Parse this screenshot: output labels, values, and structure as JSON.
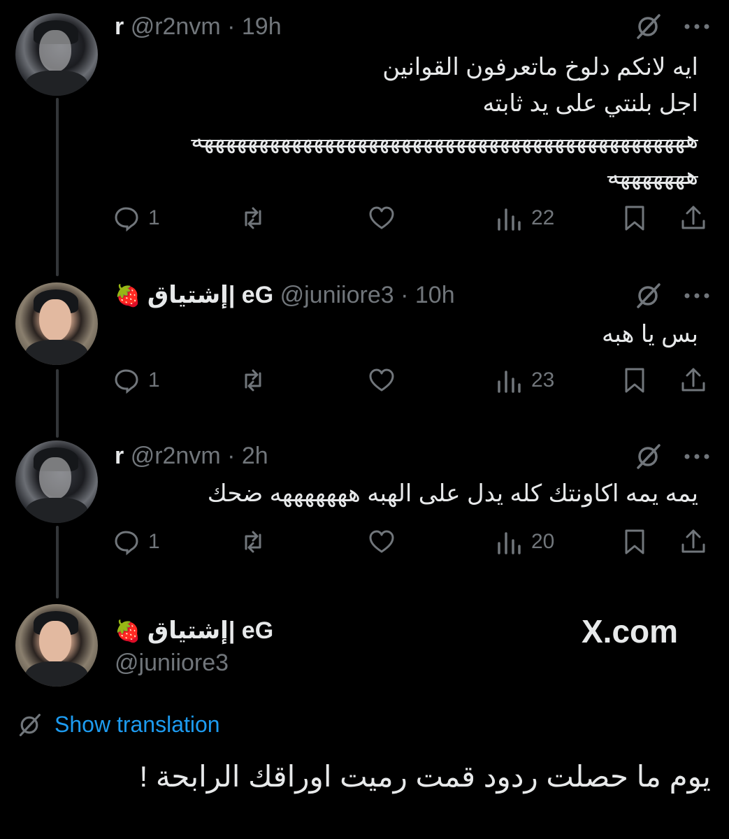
{
  "tweets": [
    {
      "name": "r",
      "handle": "@r2nvm",
      "time": "· 19h",
      "lines": [
        "ايه لانكم دلوخ ماتعرفون القوانين",
        "اجل بلنتي على يد ثابته"
      ],
      "strike_lines": [
        "هههههههههههههههههههههههههههههههههههههههههههههه",
        "هههههههه"
      ],
      "replies": "1",
      "views": "22"
    },
    {
      "name": "إشتياق| eG",
      "emoji": "🍓",
      "handle": "@juniiore3",
      "time": "· 10h",
      "lines": [
        "بس يا هبه"
      ],
      "replies": "1",
      "views": "23"
    },
    {
      "name": "r",
      "handle": "@r2nvm",
      "time": "· 2h",
      "lines": [
        "يمه يمه اكاونتك كله يدل على الهبه هههههههه ضحك"
      ],
      "replies": "1",
      "views": "20"
    }
  ],
  "main_tweet": {
    "name": "إشتياق| eG",
    "emoji": "🍓",
    "handle": "@juniiore3",
    "site": "X.com",
    "show_translation": "Show translation",
    "text": "يوم ما حصلت ردود قمت رميت اوراقك الرابحة !"
  },
  "icons": {
    "reply": "reply-icon",
    "retweet": "retweet-icon",
    "like": "heart-icon",
    "views": "views-icon",
    "bookmark": "bookmark-icon",
    "share": "share-icon",
    "grok": "grok-icon",
    "more": "more-icon"
  },
  "colors": {
    "background": "#000000",
    "text": "#e7e9ea",
    "muted": "#71767b",
    "link": "#1d9bf0"
  }
}
